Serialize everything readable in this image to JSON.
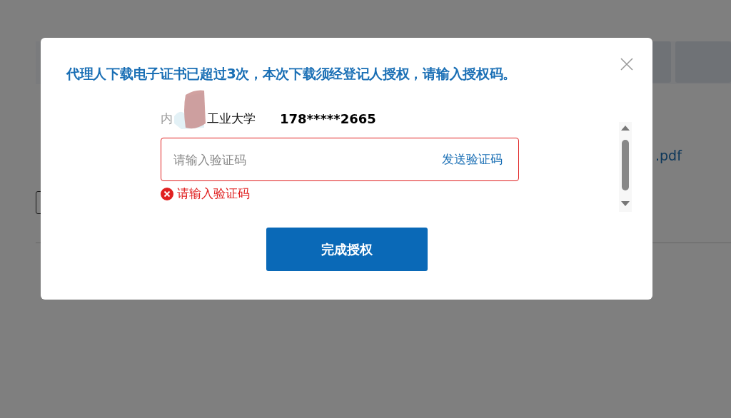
{
  "background": {
    "file_link": ".pdf"
  },
  "dialog": {
    "title": "代理人下载电子证书已超过3次，本次下载须经登记人授权，请输入授权码。",
    "org_prefix": "内",
    "org_name": "工业大学",
    "phone": "178*****2665",
    "code_field": {
      "placeholder": "请输入验证码",
      "invalid": true
    },
    "send_code_link": "发送验证码",
    "error_message": "请输入验证码",
    "submit_button": "完成授权"
  }
}
